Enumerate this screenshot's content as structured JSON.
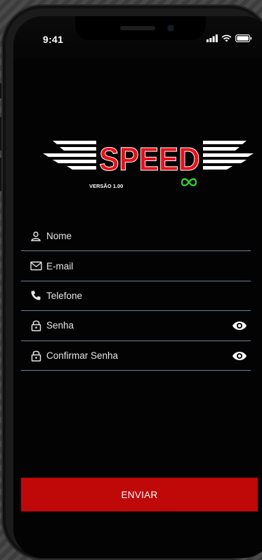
{
  "status": {
    "time": "9:41"
  },
  "logo": {
    "brand": "SPEED",
    "version": "VERSÃO 1.00"
  },
  "form": {
    "fields": [
      {
        "icon": "user-icon",
        "label": "Nome",
        "has_eye": false
      },
      {
        "icon": "mail-icon",
        "label": "E-mail",
        "has_eye": false
      },
      {
        "icon": "phone-icon",
        "label": "Telefone",
        "has_eye": false
      },
      {
        "icon": "lock-icon",
        "label": "Senha",
        "has_eye": true
      },
      {
        "icon": "lock-icon",
        "label": "Confirmar Senha",
        "has_eye": true
      }
    ],
    "submit_label": "ENVIAR"
  },
  "colors": {
    "background": "#030303",
    "accent_red": "#bf0808",
    "logo_red": "#e8101a",
    "infinity_green": "#2fd12f",
    "field_underline": "#6c7f92"
  }
}
